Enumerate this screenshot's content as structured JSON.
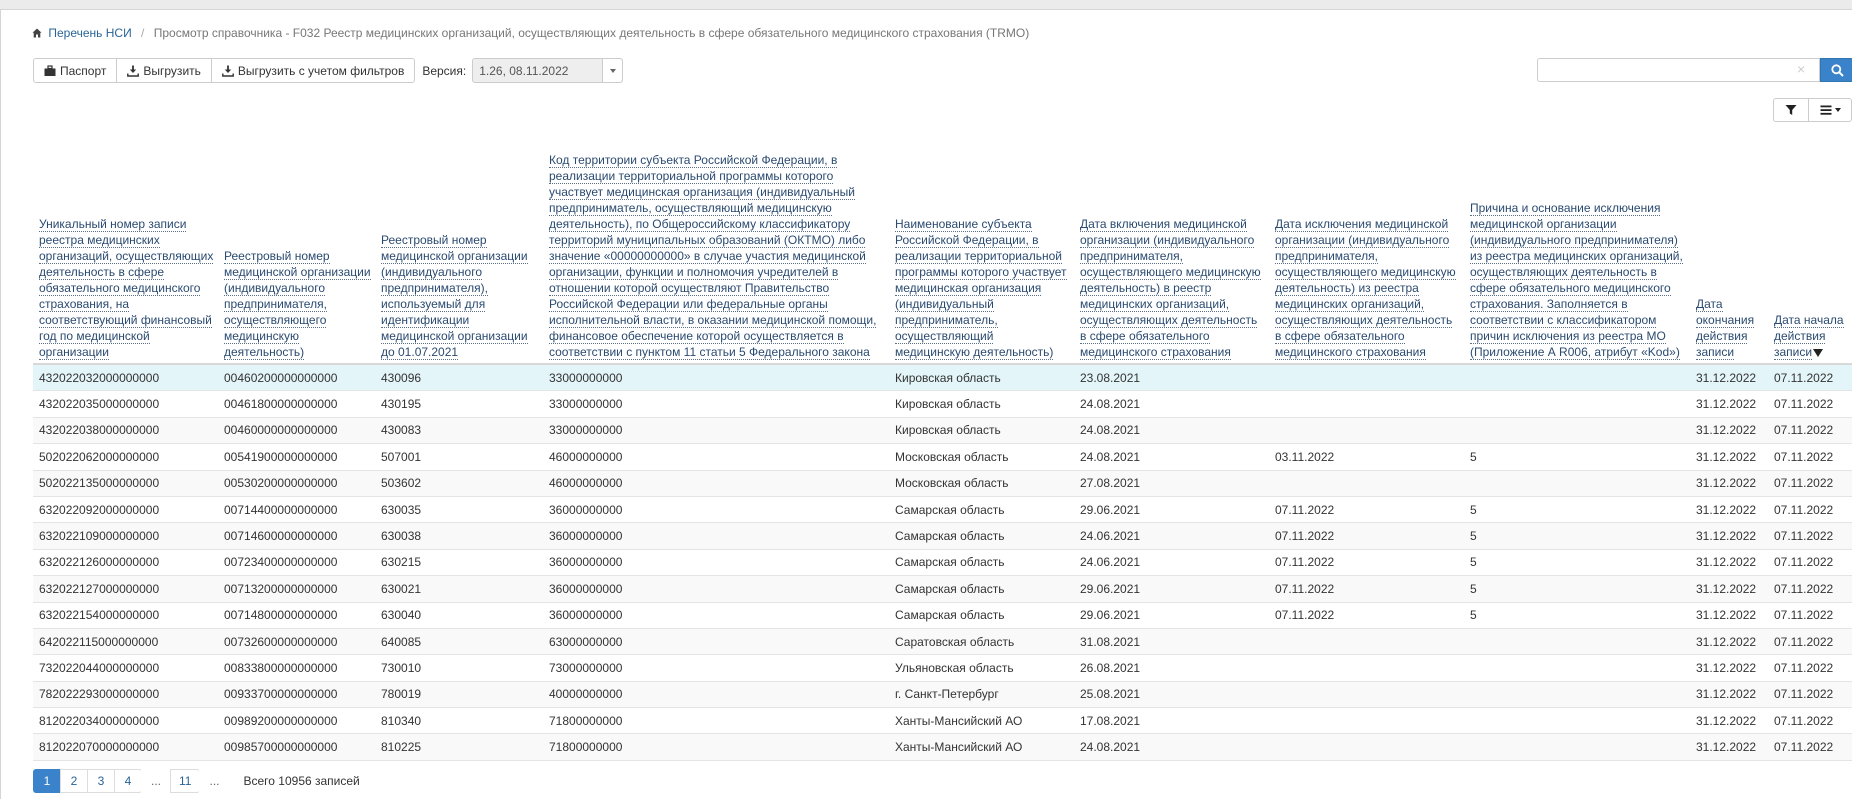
{
  "breadcrumb": {
    "home_label": "Перечень НСИ",
    "current": "Просмотр справочника - F032 Реестр медицинских организаций, осуществляющих деятельность в сфере обязательного медицинского страхования (TRMO)"
  },
  "toolbar": {
    "passport_label": "Паспорт",
    "export_label": "Выгрузить",
    "export_filtered_label": "Выгрузить с учетом фильтров",
    "version_label": "Версия:",
    "version_value": "1.26, 08.11.2022"
  },
  "search": {
    "placeholder": "",
    "value": ""
  },
  "columns": [
    "Уникальный номер записи реестра медицинских организаций, осуществляющих деятельность в сфере обязательного медицинского страхования, на соответствующий финансовый год по медицинской организации",
    "Реестровый номер медицинской организации (индивидуального предпринимателя, осуществляющего медицинскую деятельность)",
    "Реестровый номер медицинской организации (индивидуального предпринимателя), используемый для идентификации медицинской организации до 01.07.2021",
    "Код территории субъекта Российской Федерации, в реализации территориальной программы которого участвует медицинская организация (индивидуальный предприниматель, осуществляющий медицинскую деятельность), по Общероссийскому классификатору территорий муниципальных образований (ОКТМО) либо значение «00000000000» в случае участия медицинской организации, функции и полномочия учредителей в отношении которой осуществляют Правительство Российской Федерации или федеральные органы исполнительной власти, в оказании медицинской помощи, финансовое обеспечение которой осуществляется в соответствии с пунктом 11 статьи 5 Федерального закона",
    "Наименование субъекта Российской Федерации, в реализации территориальной программы которого участвует медицинская организация (индивидуальный предприниматель, осуществляющий медицинскую деятельность)",
    "Дата включения медицинской организации (индивидуального предпринимателя, осуществляющего медицинскую деятельность) в реестр медицинских организаций, осуществляющих деятельность в сфере обязательного медицинского страхования",
    "Дата исключения медицинской организации (индивидуального предпринимателя, осуществляющего медицинскую деятельность) из реестра медицинских организаций, осуществляющих деятельность в сфере обязательного медицинского страхования",
    "Причина и основание исключения медицинской организации (индивидуального предпринимателя) из реестра медицинских организаций, осуществляющих деятельность в сфере обязательного медицинского страхования. Заполняется в соответствии с классификатором причин исключения из реестра МО (Приложение А R006, атрибут «Kod»)",
    "Дата окончания действия записи",
    "Дата начала действия записи"
  ],
  "rows": [
    [
      "432022032000000000",
      "00460200000000000",
      "430096",
      "33000000000",
      "Кировская область",
      "23.08.2021",
      "",
      "",
      "31.12.2022",
      "07.11.2022"
    ],
    [
      "432022035000000000",
      "00461800000000000",
      "430195",
      "33000000000",
      "Кировская область",
      "24.08.2021",
      "",
      "",
      "31.12.2022",
      "07.11.2022"
    ],
    [
      "432022038000000000",
      "00460000000000000",
      "430083",
      "33000000000",
      "Кировская область",
      "24.08.2021",
      "",
      "",
      "31.12.2022",
      "07.11.2022"
    ],
    [
      "502022062000000000",
      "00541900000000000",
      "507001",
      "46000000000",
      "Московская область",
      "24.08.2021",
      "03.11.2022",
      "5",
      "31.12.2022",
      "07.11.2022"
    ],
    [
      "502022135000000000",
      "00530200000000000",
      "503602",
      "46000000000",
      "Московская область",
      "27.08.2021",
      "",
      "",
      "31.12.2022",
      "07.11.2022"
    ],
    [
      "632022092000000000",
      "00714400000000000",
      "630035",
      "36000000000",
      "Самарская область",
      "29.06.2021",
      "07.11.2022",
      "5",
      "31.12.2022",
      "07.11.2022"
    ],
    [
      "632022109000000000",
      "00714600000000000",
      "630038",
      "36000000000",
      "Самарская область",
      "24.06.2021",
      "07.11.2022",
      "5",
      "31.12.2022",
      "07.11.2022"
    ],
    [
      "632022126000000000",
      "00723400000000000",
      "630215",
      "36000000000",
      "Самарская область",
      "24.06.2021",
      "07.11.2022",
      "5",
      "31.12.2022",
      "07.11.2022"
    ],
    [
      "632022127000000000",
      "00713200000000000",
      "630021",
      "36000000000",
      "Самарская область",
      "29.06.2021",
      "07.11.2022",
      "5",
      "31.12.2022",
      "07.11.2022"
    ],
    [
      "632022154000000000",
      "00714800000000000",
      "630040",
      "36000000000",
      "Самарская область",
      "29.06.2021",
      "07.11.2022",
      "5",
      "31.12.2022",
      "07.11.2022"
    ],
    [
      "642022115000000000",
      "00732600000000000",
      "640085",
      "63000000000",
      "Саратовская область",
      "31.08.2021",
      "",
      "",
      "31.12.2022",
      "07.11.2022"
    ],
    [
      "732022044000000000",
      "00833800000000000",
      "730010",
      "73000000000",
      "Ульяновская область",
      "26.08.2021",
      "",
      "",
      "31.12.2022",
      "07.11.2022"
    ],
    [
      "782022293000000000",
      "00933700000000000",
      "780019",
      "40000000000",
      "г. Санкт-Петербург",
      "25.08.2021",
      "",
      "",
      "31.12.2022",
      "07.11.2022"
    ],
    [
      "812022034000000000",
      "00989200000000000",
      "810340",
      "71800000000",
      "Ханты-Мансийский АО",
      "17.08.2021",
      "",
      "",
      "31.12.2022",
      "07.11.2022"
    ],
    [
      "812022070000000000",
      "00985700000000000",
      "810225",
      "71800000000",
      "Ханты-Мансийский АО",
      "24.08.2021",
      "",
      "",
      "31.12.2022",
      "07.11.2022"
    ]
  ],
  "pagination": {
    "pages": [
      "1",
      "2",
      "3",
      "4",
      "...",
      "11",
      "..."
    ],
    "active": "1",
    "total_label": "Всего 10956 записей"
  }
}
